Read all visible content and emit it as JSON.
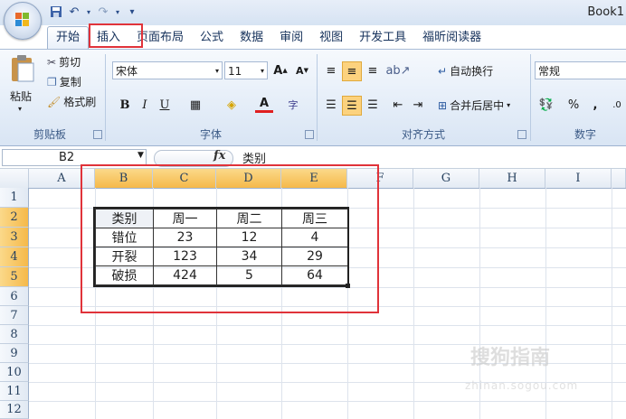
{
  "window": {
    "title": "Book1"
  },
  "tabs": [
    {
      "label": "开始",
      "active": true
    },
    {
      "label": "插入",
      "highlighted": true
    },
    {
      "label": "页面布局"
    },
    {
      "label": "公式"
    },
    {
      "label": "数据"
    },
    {
      "label": "审阅"
    },
    {
      "label": "视图"
    },
    {
      "label": "开发工具"
    },
    {
      "label": "福昕阅读器"
    }
  ],
  "clipboard": {
    "paste": "粘贴",
    "cut": "剪切",
    "copy": "复制",
    "format_painter": "格式刷",
    "group": "剪贴板"
  },
  "font": {
    "name": "宋体",
    "size": "11",
    "group": "字体",
    "bold": "B",
    "italic": "I",
    "underline": "U"
  },
  "alignment": {
    "wrap": "自动换行",
    "merge": "合并后居中",
    "group": "对齐方式"
  },
  "number": {
    "format": "常规",
    "percent": "%",
    "comma": ",",
    "group": "数字"
  },
  "formula_bar": {
    "cell": "B2",
    "fx": "fx",
    "value": "类别"
  },
  "columns": [
    "A",
    "B",
    "C",
    "D",
    "E",
    "F",
    "G",
    "H",
    "I"
  ],
  "rows": [
    "1",
    "2",
    "3",
    "4",
    "5",
    "6",
    "7",
    "8",
    "9",
    "10",
    "11",
    "12"
  ],
  "table": {
    "header": [
      "类别",
      "周一",
      "周二",
      "周三"
    ],
    "rows": [
      [
        "错位",
        "23",
        "12",
        "4"
      ],
      [
        "开裂",
        "123",
        "34",
        "29"
      ],
      [
        "破损",
        "424",
        "5",
        "64"
      ]
    ]
  },
  "colors": {
    "highlight_red": "#e0333a",
    "selected_header": "#f5b94a"
  },
  "watermark": {
    "text": "搜狗指南",
    "sub": "zhinan.sogou.com"
  }
}
